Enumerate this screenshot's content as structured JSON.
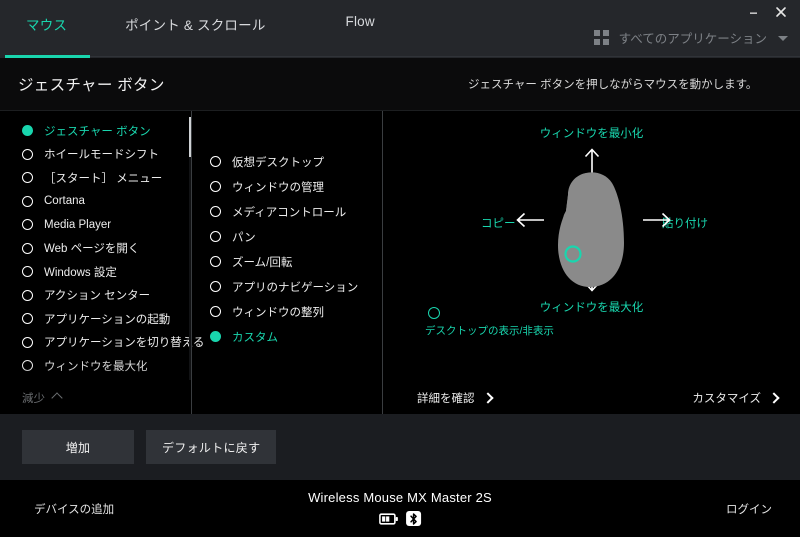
{
  "window": {
    "minimize_label": "−",
    "close_label": "✕"
  },
  "tabs": [
    {
      "label": "マウス",
      "active": true
    },
    {
      "label": "ポイント & スクロール",
      "active": false
    },
    {
      "label": "Flow",
      "active": false
    }
  ],
  "app_selector": {
    "label": "すべてのアプリケーション",
    "grid_icon": "grid-icon",
    "chevron_icon": "chevron-down-icon"
  },
  "section": {
    "title": "ジェスチャー ボタン",
    "hint": "ジェスチャー ボタンを押しながらマウスを動かします。"
  },
  "left_list": {
    "items": [
      {
        "label": "ジェスチャー ボタン",
        "selected": true
      },
      {
        "label": "ホイールモードシフト",
        "selected": false
      },
      {
        "label": "［スタート］ メニュー",
        "selected": false
      },
      {
        "label": "Cortana",
        "selected": false
      },
      {
        "label": "Media Player",
        "selected": false
      },
      {
        "label": "Web ページを開く",
        "selected": false
      },
      {
        "label": "Windows 設定",
        "selected": false
      },
      {
        "label": "アクション センター",
        "selected": false
      },
      {
        "label": "アプリケーションの起動",
        "selected": false
      },
      {
        "label": "アプリケーションを切り替える",
        "selected": false
      },
      {
        "label": "ウィンドウを最大化",
        "selected": false
      }
    ],
    "collapse_label": "減少"
  },
  "mid_list": {
    "items": [
      {
        "label": "仮想デスクトップ",
        "selected": false
      },
      {
        "label": "ウィンドウの管理",
        "selected": false
      },
      {
        "label": "メディアコントロール",
        "selected": false
      },
      {
        "label": "パン",
        "selected": false
      },
      {
        "label": "ズーム/回転",
        "selected": false
      },
      {
        "label": "アプリのナビゲーション",
        "selected": false
      },
      {
        "label": "ウィンドウの整列",
        "selected": false
      },
      {
        "label": "カスタム",
        "selected": true
      }
    ]
  },
  "diagram": {
    "up_label": "ウィンドウを最小化",
    "down_label": "ウィンドウを最大化",
    "left_label": "コピー",
    "right_label": "貼り付け",
    "desktop_toggle_label": "デスクトップの表示/非表示",
    "mouse_icon": "mouse-silhouette",
    "gesture_button_icon": "gesture-button-marker",
    "accent_color": "#19d6ae",
    "mouse_color": "#8a8a8a"
  },
  "right_links": {
    "details": "詳細を確認",
    "customize": "カスタマイズ"
  },
  "buttons": {
    "add": "増加",
    "reset": "デフォルトに戻す"
  },
  "status": {
    "add_device": "デバイスの追加",
    "device_name": "Wireless Mouse MX Master 2S",
    "login": "ログイン",
    "battery_icon": "battery-icon",
    "bluetooth_icon": "bluetooth-icon"
  }
}
